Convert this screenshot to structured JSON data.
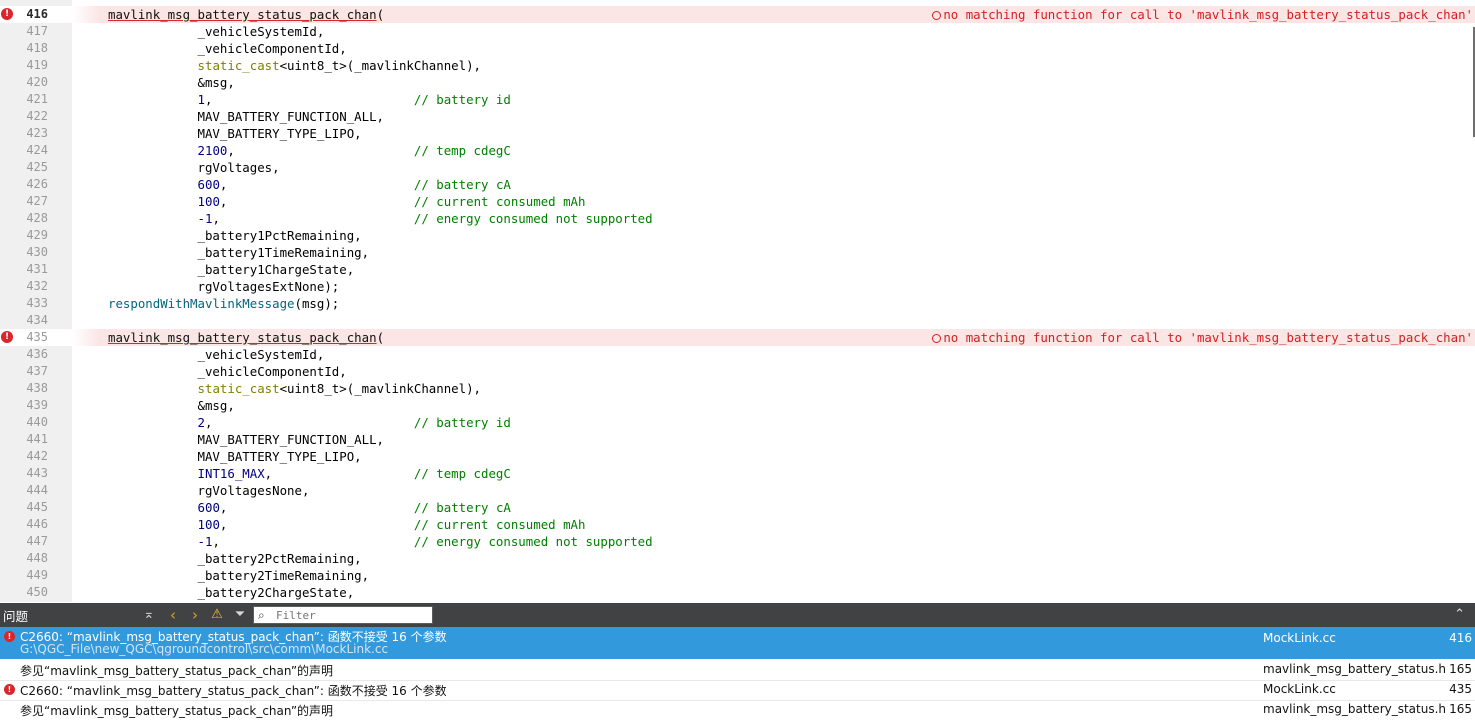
{
  "editor": {
    "lines": [
      {
        "n": "416",
        "current": true,
        "error": true,
        "tokens": [
          {
            "c": "c-err",
            "t": "mavlink_msg_battery_status_pack_chan"
          },
          {
            "c": "c-id",
            "t": "("
          }
        ],
        "diag": "no matching function for call to 'mavlink_msg_battery_status_pack_chan'"
      },
      {
        "n": "417",
        "tokens": [
          {
            "c": "c-id",
            "t": "            _vehicleSystemId,"
          }
        ]
      },
      {
        "n": "418",
        "tokens": [
          {
            "c": "c-id",
            "t": "            _vehicleComponentId,"
          }
        ]
      },
      {
        "n": "419",
        "tokens": [
          {
            "c": "c-id",
            "t": "            "
          },
          {
            "c": "c-kw",
            "t": "static_cast"
          },
          {
            "c": "c-id",
            "t": "<uint8_t>(_mavlinkChannel),"
          }
        ]
      },
      {
        "n": "420",
        "tokens": [
          {
            "c": "c-id",
            "t": "            &msg,"
          }
        ]
      },
      {
        "n": "421",
        "tokens": [
          {
            "c": "c-id",
            "t": "            "
          },
          {
            "c": "c-num",
            "t": "1"
          },
          {
            "c": "c-id",
            "t": ",                           "
          },
          {
            "c": "c-cmt",
            "t": "// battery id"
          }
        ]
      },
      {
        "n": "422",
        "tokens": [
          {
            "c": "c-id",
            "t": "            MAV_BATTERY_FUNCTION_ALL,"
          }
        ]
      },
      {
        "n": "423",
        "tokens": [
          {
            "c": "c-id",
            "t": "            MAV_BATTERY_TYPE_LIPO,"
          }
        ]
      },
      {
        "n": "424",
        "tokens": [
          {
            "c": "c-id",
            "t": "            "
          },
          {
            "c": "c-num",
            "t": "2100"
          },
          {
            "c": "c-id",
            "t": ",                        "
          },
          {
            "c": "c-cmt",
            "t": "// temp cdegC"
          }
        ]
      },
      {
        "n": "425",
        "tokens": [
          {
            "c": "c-id",
            "t": "            rgVoltages,"
          }
        ]
      },
      {
        "n": "426",
        "tokens": [
          {
            "c": "c-id",
            "t": "            "
          },
          {
            "c": "c-num",
            "t": "600"
          },
          {
            "c": "c-id",
            "t": ",                         "
          },
          {
            "c": "c-cmt",
            "t": "// battery cA"
          }
        ]
      },
      {
        "n": "427",
        "tokens": [
          {
            "c": "c-id",
            "t": "            "
          },
          {
            "c": "c-num",
            "t": "100"
          },
          {
            "c": "c-id",
            "t": ",                         "
          },
          {
            "c": "c-cmt",
            "t": "// current consumed mAh"
          }
        ]
      },
      {
        "n": "428",
        "tokens": [
          {
            "c": "c-id",
            "t": "            "
          },
          {
            "c": "c-num",
            "t": "-1"
          },
          {
            "c": "c-id",
            "t": ",                          "
          },
          {
            "c": "c-cmt",
            "t": "// energy consumed not supported"
          }
        ]
      },
      {
        "n": "429",
        "tokens": [
          {
            "c": "c-id",
            "t": "            _battery1PctRemaining,"
          }
        ]
      },
      {
        "n": "430",
        "tokens": [
          {
            "c": "c-id",
            "t": "            _battery1TimeRemaining,"
          }
        ]
      },
      {
        "n": "431",
        "tokens": [
          {
            "c": "c-id",
            "t": "            _battery1ChargeState,"
          }
        ]
      },
      {
        "n": "432",
        "tokens": [
          {
            "c": "c-id",
            "t": "            rgVoltagesExtNone);"
          }
        ]
      },
      {
        "n": "433",
        "tokens": [
          {
            "c": "c-fn",
            "t": "respondWithMavlinkMessage"
          },
          {
            "c": "c-id",
            "t": "(msg);"
          }
        ]
      },
      {
        "n": "434",
        "tokens": []
      },
      {
        "n": "435",
        "error": true,
        "tokens": [
          {
            "c": "c-err",
            "t": "mavlink_msg_battery_status_pack_chan"
          },
          {
            "c": "c-id",
            "t": "("
          }
        ],
        "diag": "no matching function for call to 'mavlink_msg_battery_status_pack_chan'"
      },
      {
        "n": "436",
        "tokens": [
          {
            "c": "c-id",
            "t": "            _vehicleSystemId,"
          }
        ]
      },
      {
        "n": "437",
        "tokens": [
          {
            "c": "c-id",
            "t": "            _vehicleComponentId,"
          }
        ]
      },
      {
        "n": "438",
        "tokens": [
          {
            "c": "c-id",
            "t": "            "
          },
          {
            "c": "c-kw",
            "t": "static_cast"
          },
          {
            "c": "c-id",
            "t": "<uint8_t>(_mavlinkChannel),"
          }
        ]
      },
      {
        "n": "439",
        "tokens": [
          {
            "c": "c-id",
            "t": "            &msg,"
          }
        ]
      },
      {
        "n": "440",
        "tokens": [
          {
            "c": "c-id",
            "t": "            "
          },
          {
            "c": "c-num",
            "t": "2"
          },
          {
            "c": "c-id",
            "t": ",                           "
          },
          {
            "c": "c-cmt",
            "t": "// battery id"
          }
        ]
      },
      {
        "n": "441",
        "tokens": [
          {
            "c": "c-id",
            "t": "            MAV_BATTERY_FUNCTION_ALL,"
          }
        ]
      },
      {
        "n": "442",
        "tokens": [
          {
            "c": "c-id",
            "t": "            MAV_BATTERY_TYPE_LIPO,"
          }
        ]
      },
      {
        "n": "443",
        "tokens": [
          {
            "c": "c-id",
            "t": "            "
          },
          {
            "c": "c-num",
            "t": "INT16_MAX"
          },
          {
            "c": "c-id",
            "t": ",                   "
          },
          {
            "c": "c-cmt",
            "t": "// temp cdegC"
          }
        ]
      },
      {
        "n": "444",
        "tokens": [
          {
            "c": "c-id",
            "t": "            rgVoltagesNone,"
          }
        ]
      },
      {
        "n": "445",
        "tokens": [
          {
            "c": "c-id",
            "t": "            "
          },
          {
            "c": "c-num",
            "t": "600"
          },
          {
            "c": "c-id",
            "t": ",                         "
          },
          {
            "c": "c-cmt",
            "t": "// battery cA"
          }
        ]
      },
      {
        "n": "446",
        "tokens": [
          {
            "c": "c-id",
            "t": "            "
          },
          {
            "c": "c-num",
            "t": "100"
          },
          {
            "c": "c-id",
            "t": ",                         "
          },
          {
            "c": "c-cmt",
            "t": "// current consumed mAh"
          }
        ]
      },
      {
        "n": "447",
        "tokens": [
          {
            "c": "c-id",
            "t": "            "
          },
          {
            "c": "c-num",
            "t": "-1"
          },
          {
            "c": "c-id",
            "t": ",                          "
          },
          {
            "c": "c-cmt",
            "t": "// energy consumed not supported"
          }
        ]
      },
      {
        "n": "448",
        "tokens": [
          {
            "c": "c-id",
            "t": "            _battery2PctRemaining,"
          }
        ]
      },
      {
        "n": "449",
        "tokens": [
          {
            "c": "c-id",
            "t": "            _battery2TimeRemaining,"
          }
        ]
      },
      {
        "n": "450",
        "tokens": [
          {
            "c": "c-id",
            "t": "            _battery2ChargeState,"
          }
        ]
      }
    ]
  },
  "issues_panel": {
    "title": "问题",
    "filter_placeholder": "Filter",
    "icons": {
      "toggle": "clean-icon",
      "prev": "arrow-left-icon",
      "next": "arrow-right-icon",
      "warning": "warning-icon",
      "filter": "filter-icon",
      "collapse": "chevron-up-icon"
    },
    "rows": [
      {
        "selected": true,
        "error": true,
        "message": "C2660: “mavlink_msg_battery_status_pack_chan”: 函数不接受 16 个参数",
        "path": "G:\\QGC_File\\new_QGC\\qgroundcontrol\\src\\comm\\MockLink.cc",
        "file": "MockLink.cc",
        "line": "416"
      },
      {
        "selected": false,
        "error": false,
        "message": "参见“mavlink_msg_battery_status_pack_chan”的声明",
        "file": "mavlink_msg_battery_status.h",
        "line": "165"
      },
      {
        "selected": false,
        "error": true,
        "message": "C2660: “mavlink_msg_battery_status_pack_chan”: 函数不接受 16 个参数",
        "file": "MockLink.cc",
        "line": "435"
      },
      {
        "selected": false,
        "error": false,
        "message": "参见“mavlink_msg_battery_status_pack_chan”的声明",
        "file": "mavlink_msg_battery_status.h",
        "line": "165"
      }
    ]
  }
}
